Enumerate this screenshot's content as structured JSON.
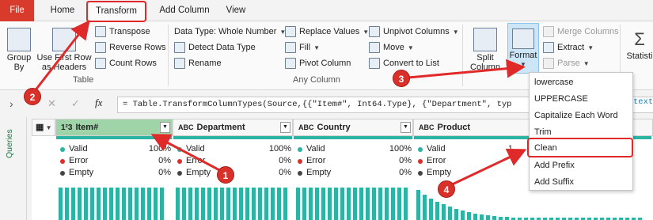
{
  "tabs": [
    "File",
    "Home",
    "Transform",
    "Add Column",
    "View"
  ],
  "ribbon": {
    "table_group": {
      "group_by": "Group\nBy",
      "use_first_row": "Use First Row\nas Headers",
      "transpose": "Transpose",
      "reverse_rows": "Reverse Rows",
      "count_rows": "Count Rows",
      "label": "Table"
    },
    "any_column_group": {
      "data_type": "Data Type: Whole Number",
      "detect_data_type": "Detect Data Type",
      "rename": "Rename",
      "replace_values": "Replace Values",
      "fill": "Fill",
      "pivot_column": "Pivot Column",
      "unpivot_columns": "Unpivot Columns",
      "move": "Move",
      "convert_to_list": "Convert to List",
      "label": "Any Column"
    },
    "text_group": {
      "split_column": "Split\nColumn",
      "format": "Format",
      "merge_columns": "Merge Columns",
      "extract": "Extract",
      "parse": "Parse",
      "statistics": "Statisti"
    }
  },
  "formula": "= Table.TransformColumnTypes(Source,{{\"Item#\", Int64.Type}, {\"Department\", typ",
  "formula_tail": "text",
  "queries_label": "Queries",
  "columns": [
    {
      "type_icon": "1²3",
      "name": "Item#",
      "valid": "100%",
      "error": "0%",
      "empty": "0%"
    },
    {
      "type_icon": "ABC",
      "name": "Department",
      "valid": "100%",
      "error": "0%",
      "empty": "0%"
    },
    {
      "type_icon": "ABC",
      "name": "Country",
      "valid": "100%",
      "error": "0%",
      "empty": "0%"
    },
    {
      "type_icon": "ABC",
      "name": "Product",
      "valid": "1",
      "error": "",
      "empty": ""
    }
  ],
  "stats_labels": {
    "valid": "Valid",
    "error": "Error",
    "empty": "Empty"
  },
  "format_menu": [
    "lowercase",
    "UPPERCASE",
    "Capitalize Each Word",
    "Trim",
    "Clean",
    "Add Prefix",
    "Add Suffix"
  ],
  "callouts": [
    "1",
    "2",
    "3",
    "4"
  ],
  "colors": {
    "accent_teal": "#2bb3a3",
    "callout_red": "#d9302a",
    "file_tab": "#d83b2b",
    "selected_header": "#9fd3a8"
  }
}
